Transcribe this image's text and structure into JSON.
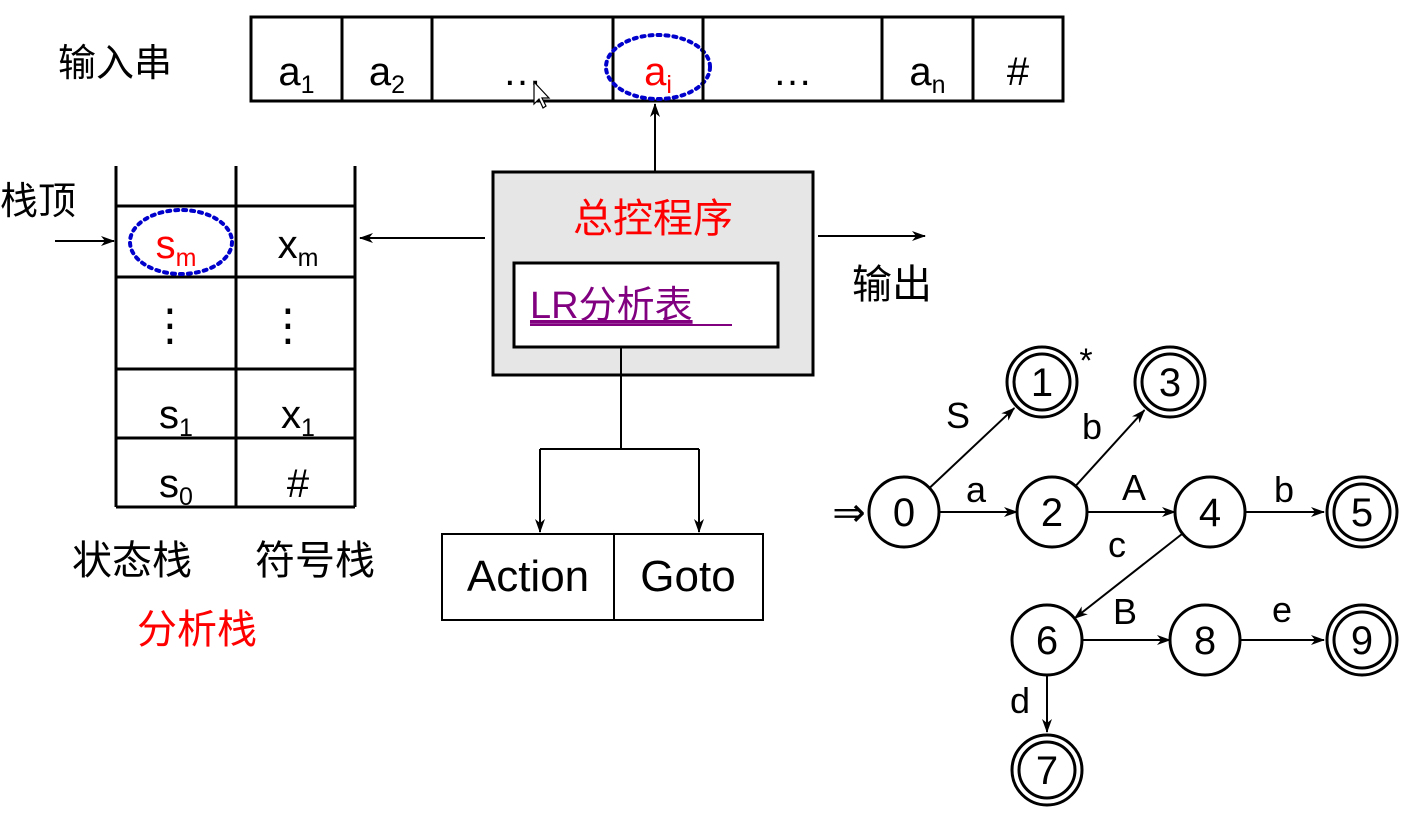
{
  "input_string": {
    "label": "输入串",
    "cells": [
      {
        "base": "a",
        "sub": "1",
        "highlight": false
      },
      {
        "base": "a",
        "sub": "2",
        "highlight": false
      },
      {
        "base": "…",
        "sub": "",
        "highlight": false
      },
      {
        "base": "a",
        "sub": "i",
        "highlight": true
      },
      {
        "base": "…",
        "sub": "",
        "highlight": false
      },
      {
        "base": "a",
        "sub": "n",
        "highlight": false
      },
      {
        "base": "#",
        "sub": "",
        "highlight": false
      }
    ]
  },
  "stack": {
    "top_label": "栈顶",
    "state_rows": [
      {
        "base": "s",
        "sub": "m",
        "highlight": true
      },
      {
        "base": "⋮",
        "sub": "",
        "highlight": false
      },
      {
        "base": "s",
        "sub": "1",
        "highlight": false
      },
      {
        "base": "s",
        "sub": "0",
        "highlight": false
      }
    ],
    "symbol_rows": [
      {
        "base": "X",
        "sub": "m"
      },
      {
        "base": "⋮",
        "sub": ""
      },
      {
        "base": "X",
        "sub": "1"
      },
      {
        "base": "#",
        "sub": ""
      }
    ],
    "state_stack_label": "状态栈",
    "symbol_stack_label": "符号栈",
    "analysis_stack_label": "分析栈"
  },
  "controller": {
    "title": "总控程序",
    "table_link": "LR分析表",
    "output_label": "输出"
  },
  "table_parts": {
    "action": "Action",
    "goto": "Goto"
  },
  "automaton": {
    "states": [
      {
        "id": "0",
        "accepting": false
      },
      {
        "id": "1",
        "accepting": true,
        "mark": "*"
      },
      {
        "id": "2",
        "accepting": false
      },
      {
        "id": "3",
        "accepting": true
      },
      {
        "id": "4",
        "accepting": false
      },
      {
        "id": "5",
        "accepting": true
      },
      {
        "id": "6",
        "accepting": false
      },
      {
        "id": "7",
        "accepting": true
      },
      {
        "id": "8",
        "accepting": false
      },
      {
        "id": "9",
        "accepting": true
      }
    ],
    "transitions": [
      {
        "from": "0",
        "to": "1",
        "label": "S"
      },
      {
        "from": "0",
        "to": "2",
        "label": "a"
      },
      {
        "from": "2",
        "to": "3",
        "label": "b"
      },
      {
        "from": "2",
        "to": "4",
        "label": "A"
      },
      {
        "from": "4",
        "to": "5",
        "label": "b"
      },
      {
        "from": "4",
        "to": "6",
        "label": "c"
      },
      {
        "from": "6",
        "to": "8",
        "label": "B"
      },
      {
        "from": "8",
        "to": "9",
        "label": "e"
      },
      {
        "from": "6",
        "to": "7",
        "label": "d"
      }
    ],
    "start_marker": "⇒"
  },
  "colors": {
    "highlight": "#ff0000",
    "link": "#800080",
    "dotted_ellipse": "#0000cc",
    "controller_fill": "#e6e6e6"
  }
}
